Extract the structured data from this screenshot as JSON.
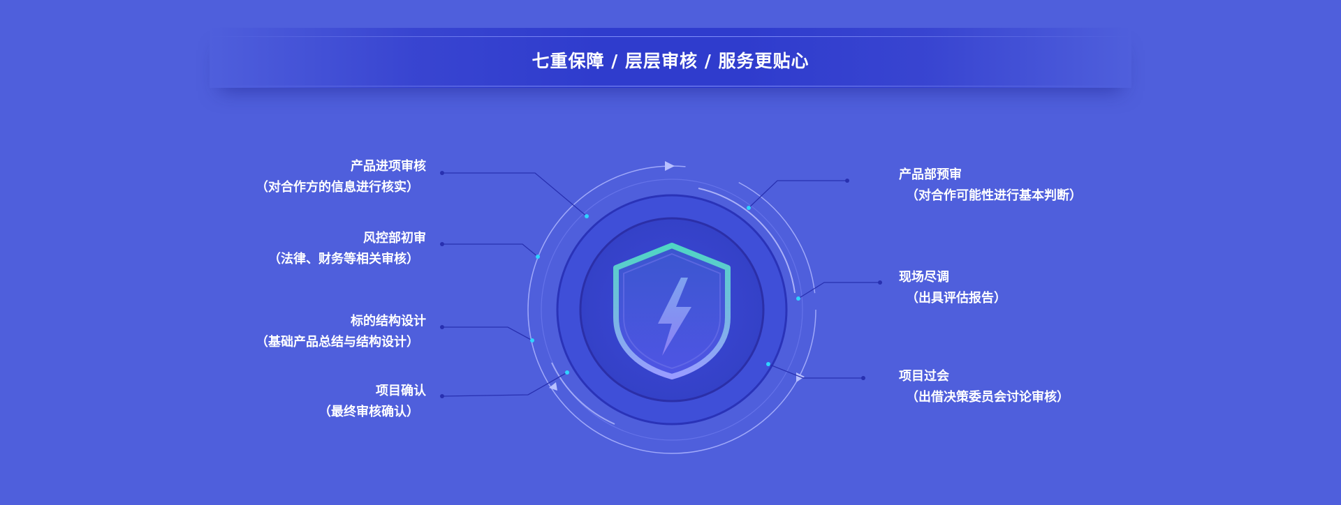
{
  "header": {
    "title": "七重保障 / 层层审核 / 服务更贴心"
  },
  "left_items": [
    {
      "title": "产品进项审核",
      "desc": "（对合作方的信息进行核实）"
    },
    {
      "title": "风控部初审",
      "desc": "（法律、财务等相关审核）"
    },
    {
      "title": "标的结构设计",
      "desc": "（基础产品总结与结构设计）"
    },
    {
      "title": "项目确认",
      "desc": "（最终审核确认）"
    }
  ],
  "right_items": [
    {
      "title": "产品部预审",
      "desc": "（对合作可能性进行基本判断）"
    },
    {
      "title": "现场尽调",
      "desc": "（出具评估报告）"
    },
    {
      "title": "项目过会",
      "desc": "（出借决策委员会讨论审核）"
    }
  ],
  "center": {
    "icon": "shield-lightning-icon"
  },
  "colors": {
    "background": "#4f5fdc",
    "banner": "#2f3ccd",
    "connector": "#2830b0",
    "dot": "#2fd3ff",
    "shield_top": "#49d3c0",
    "shield_bottom": "#8f96ff"
  }
}
